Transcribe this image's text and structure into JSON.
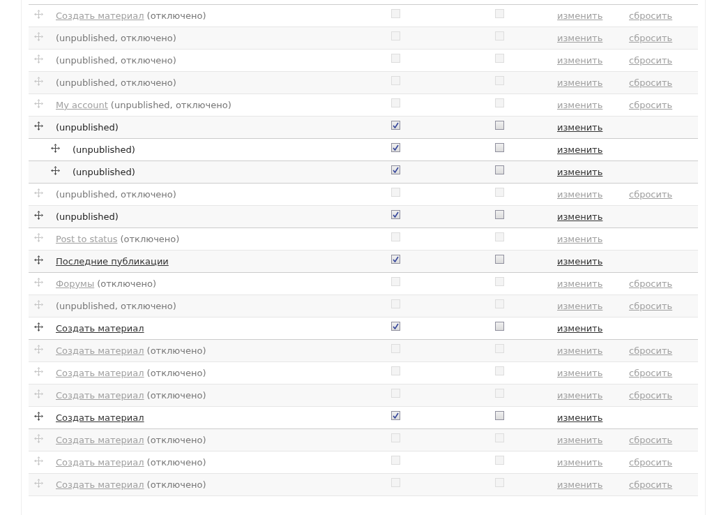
{
  "rows": [
    {
      "link": "Создать материал",
      "note": "(отключено)",
      "disabled": true,
      "enabled_checked": false,
      "expanded_checked": false,
      "edit": "изменить",
      "reset": "сбросить"
    },
    {
      "note": "(unpublished, отключено)",
      "disabled": true,
      "enabled_checked": false,
      "expanded_checked": false,
      "edit": "изменить",
      "reset": "сбросить"
    },
    {
      "note": "(unpublished, отключено)",
      "disabled": true,
      "enabled_checked": false,
      "expanded_checked": false,
      "edit": "изменить",
      "reset": "сбросить"
    },
    {
      "note": "(unpublished, отключено)",
      "disabled": true,
      "enabled_checked": false,
      "expanded_checked": false,
      "edit": "изменить",
      "reset": "сбросить"
    },
    {
      "link": "My account",
      "note": "(unpublished, отключено)",
      "disabled": true,
      "enabled_checked": false,
      "expanded_checked": false,
      "edit": "изменить",
      "reset": "сбросить"
    },
    {
      "note": "(unpublished)",
      "disabled": false,
      "enabled_checked": true,
      "expanded_checked": false,
      "edit": "изменить",
      "children": [
        {
          "note": "(unpublished)",
          "disabled": false,
          "enabled_checked": true,
          "expanded_checked": false,
          "edit": "изменить"
        },
        {
          "note": "(unpublished)",
          "disabled": false,
          "enabled_checked": true,
          "expanded_checked": false,
          "edit": "изменить"
        }
      ]
    },
    {
      "note": "(unpublished, отключено)",
      "disabled": true,
      "enabled_checked": false,
      "expanded_checked": false,
      "edit": "изменить",
      "reset": "сбросить"
    },
    {
      "note": "(unpublished)",
      "disabled": false,
      "enabled_checked": true,
      "expanded_checked": false,
      "edit": "изменить"
    },
    {
      "link": "Post to status",
      "note": "(отключено)",
      "disabled": true,
      "enabled_checked": false,
      "expanded_checked": false,
      "edit": "изменить"
    },
    {
      "link": "Последние публикации",
      "disabled": false,
      "enabled_checked": true,
      "expanded_checked": false,
      "edit": "изменить"
    },
    {
      "link": "Форумы",
      "note": "(отключено)",
      "disabled": true,
      "enabled_checked": false,
      "expanded_checked": false,
      "edit": "изменить",
      "reset": "сбросить"
    },
    {
      "note": "(unpublished, отключено)",
      "disabled": true,
      "enabled_checked": false,
      "expanded_checked": false,
      "edit": "изменить",
      "reset": "сбросить"
    },
    {
      "link": "Создать материал",
      "disabled": false,
      "enabled_checked": true,
      "expanded_checked": false,
      "edit": "изменить"
    },
    {
      "link": "Создать материал",
      "note": "(отключено)",
      "disabled": true,
      "enabled_checked": false,
      "expanded_checked": false,
      "edit": "изменить",
      "reset": "сбросить"
    },
    {
      "link": "Создать материал",
      "note": "(отключено)",
      "disabled": true,
      "enabled_checked": false,
      "expanded_checked": false,
      "edit": "изменить",
      "reset": "сбросить"
    },
    {
      "link": "Создать материал",
      "note": "(отключено)",
      "disabled": true,
      "enabled_checked": false,
      "expanded_checked": false,
      "edit": "изменить",
      "reset": "сбросить"
    },
    {
      "link": "Создать материал",
      "disabled": false,
      "enabled_checked": true,
      "expanded_checked": false,
      "edit": "изменить"
    },
    {
      "link": "Создать материал",
      "note": "(отключено)",
      "disabled": true,
      "enabled_checked": false,
      "expanded_checked": false,
      "edit": "изменить",
      "reset": "сбросить"
    },
    {
      "link": "Создать материал",
      "note": "(отключено)",
      "disabled": true,
      "enabled_checked": false,
      "expanded_checked": false,
      "edit": "изменить",
      "reset": "сбросить"
    },
    {
      "link": "Создать материал",
      "note": "(отключено)",
      "disabled": true,
      "enabled_checked": false,
      "expanded_checked": false,
      "edit": "изменить",
      "reset": "сбросить"
    }
  ]
}
